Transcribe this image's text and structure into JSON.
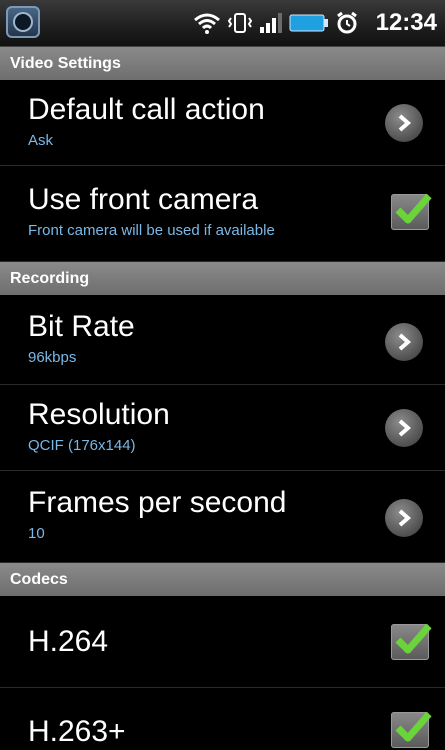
{
  "status_bar": {
    "time": "12:34",
    "icons": [
      "app-icon",
      "wifi-icon",
      "vibrate-icon",
      "signal-icon",
      "battery-icon",
      "alarm-icon"
    ]
  },
  "sections": {
    "video": {
      "label": "Video Settings"
    },
    "recording": {
      "label": "Recording"
    },
    "codecs": {
      "label": "Codecs"
    }
  },
  "prefs": {
    "default_call_action": {
      "title": "Default call action",
      "summary": "Ask"
    },
    "use_front_camera": {
      "title": "Use front camera",
      "summary": "Front camera will be used if available",
      "checked": true
    },
    "bit_rate": {
      "title": "Bit Rate",
      "summary": "96kbps"
    },
    "resolution": {
      "title": "Resolution",
      "summary": "QCIF (176x144)"
    },
    "frames_per_second": {
      "title": "Frames per second",
      "summary": "10"
    },
    "h264": {
      "title": "H.264",
      "checked": true
    },
    "h263plus": {
      "title": "H.263+",
      "checked": true
    }
  },
  "colors": {
    "summary_text": "#7ab8e6",
    "check_mark": "#6ad43a",
    "section_header": "#7a7a7a"
  }
}
